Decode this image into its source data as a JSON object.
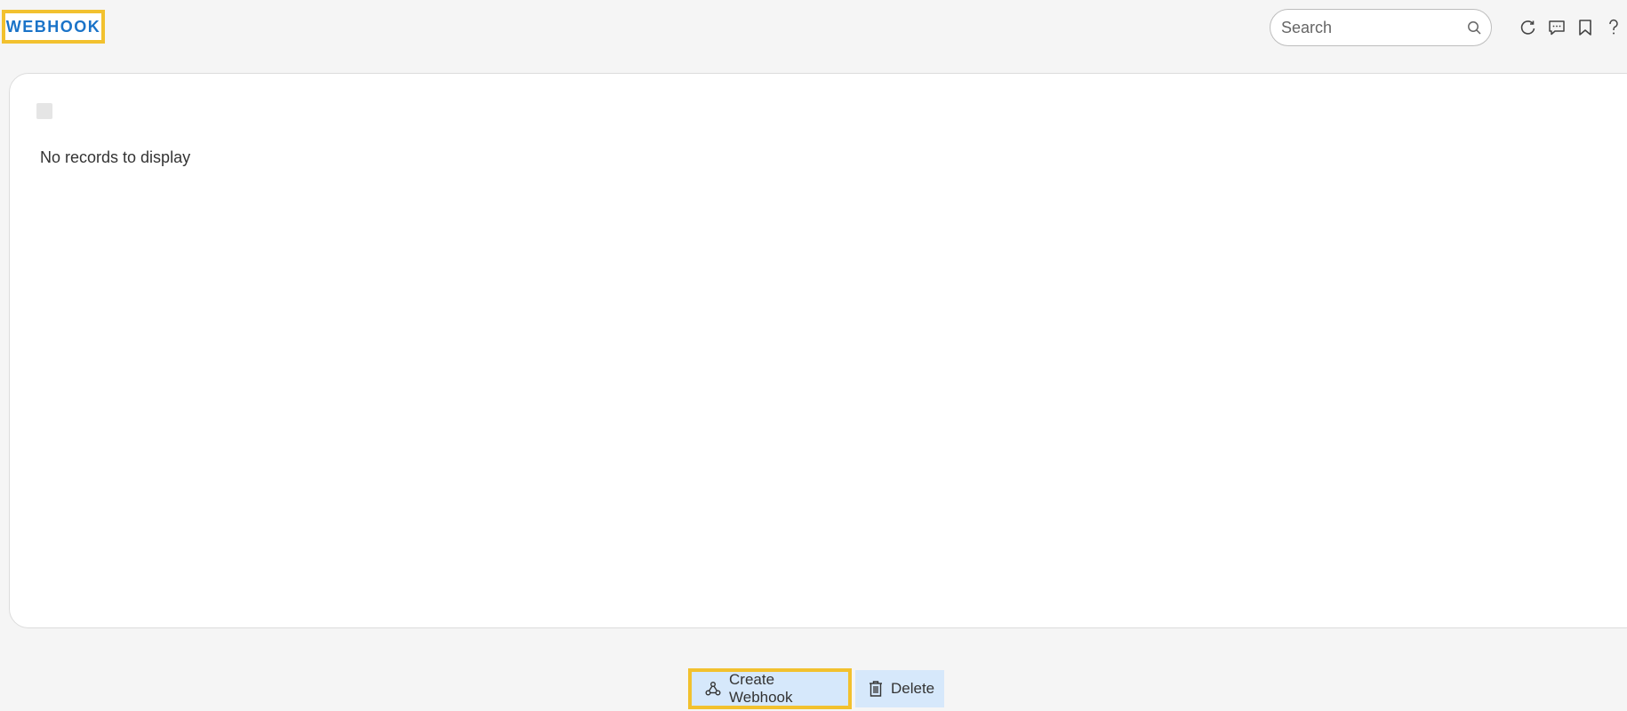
{
  "header": {
    "title": "WEBHOOK",
    "search": {
      "placeholder": "Search",
      "value": ""
    },
    "icons": [
      "refresh-icon",
      "comment-icon",
      "bookmark-icon",
      "help-icon"
    ]
  },
  "table": {
    "empty_message": "No records to display"
  },
  "actions": {
    "create_label": "Create Webhook",
    "delete_label": "Delete"
  },
  "colors": {
    "accent": "#1a73c8",
    "highlight": "#f2c12e",
    "button_bg": "#d6e8fb"
  }
}
